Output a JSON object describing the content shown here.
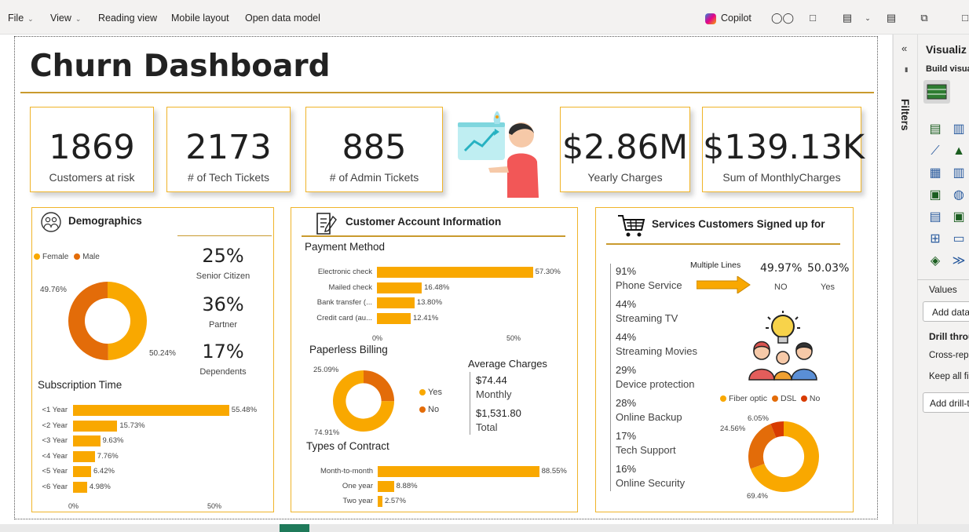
{
  "menubar": {
    "file": "File",
    "view": "View",
    "reading_view": "Reading view",
    "mobile_layout": "Mobile layout",
    "open_data_model": "Open data model",
    "copilot": "Copilot"
  },
  "report": {
    "title": "Churn Dashboard",
    "kpis": [
      {
        "value": "1869",
        "label": "Customers at risk"
      },
      {
        "value": "2173",
        "label": "# of Tech Tickets"
      },
      {
        "value": "885",
        "label": "# of Admin Tickets"
      },
      {
        "value": "$2.86M",
        "label": "Yearly Charges"
      },
      {
        "value": "$139.13K",
        "label": "Sum of MonthlyCharges"
      }
    ]
  },
  "demographics": {
    "title": "Demographics",
    "legend_female": "Female",
    "legend_male": "Male",
    "female_pct_label": "49.76%",
    "male_pct_label": "50.24%",
    "senior_value": "25%",
    "senior_label": "Senior Citizen",
    "partner_value": "36%",
    "partner_label": "Partner",
    "dependents_value": "17%",
    "dependents_label": "Dependents",
    "subscription_title": "Subscription Time",
    "axis_start": "0%",
    "axis_mid": "50%"
  },
  "account": {
    "title": "Customer Account Information",
    "payment_title": "Payment Method",
    "payment_axis_start": "0%",
    "payment_axis_mid": "50%",
    "paperless_title": "Paperless Billing",
    "paperless_yes": "Yes",
    "paperless_no": "No",
    "paperless_no_label": "25.09%",
    "paperless_yes_label": "74.91%",
    "avg_title": "Average Charges",
    "avg_monthly_value": "$74.44",
    "avg_monthly_label": "Monthly",
    "avg_total_value": "$1,531.80",
    "avg_total_label": "Total",
    "contract_title": "Types of Contract"
  },
  "services": {
    "title": "Services Customers Signed up for",
    "items": [
      {
        "pct": "91%",
        "name": "Phone Service"
      },
      {
        "pct": "44%",
        "name": "Streaming TV"
      },
      {
        "pct": "44%",
        "name": "Streaming Movies"
      },
      {
        "pct": "29%",
        "name": "Device protection"
      },
      {
        "pct": "28%",
        "name": "Online Backup"
      },
      {
        "pct": "17%",
        "name": "Tech Support"
      },
      {
        "pct": "16%",
        "name": "Online Security"
      }
    ],
    "multiple_lines_label": "Multiple Lines",
    "ml_no_value": "49.97%",
    "ml_no_label": "NO",
    "ml_yes_value": "50.03%",
    "ml_yes_label": "Yes",
    "legend_fiber": "Fiber optic",
    "legend_dsl": "DSL",
    "legend_no": "No",
    "internet_no_label": "6.05%",
    "internet_dsl_label": "24.56%",
    "internet_fiber_label": "69.4%"
  },
  "right_panel": {
    "filters": "Filters",
    "visualizations": "Visualiz",
    "build_visual": "Build visua",
    "values": "Values",
    "add_data": "Add data",
    "drill_through": "Drill throu",
    "cross_report": "Cross-repo",
    "keep_all": "Keep all fi",
    "add_drill": "Add drill-t"
  },
  "colors": {
    "accent": "#f9a800",
    "dark_orange": "#e36c09",
    "red": "#d83b01",
    "border": "#f0b429"
  },
  "chart_data": [
    {
      "type": "pie",
      "title": "",
      "categories": [
        "Female",
        "Male"
      ],
      "values": [
        49.76,
        50.24
      ],
      "donut": true
    },
    {
      "type": "bar",
      "title": "Subscription Time",
      "categories": [
        "<1 Year",
        "<2 Year",
        "<3 Year",
        "<4 Year",
        "<5 Year",
        "<6 Year"
      ],
      "values": [
        55.48,
        15.73,
        9.63,
        7.76,
        6.42,
        4.98
      ],
      "value_labels": [
        "55.48%",
        "15.73%",
        "9.63%",
        "7.76%",
        "6.42%",
        "4.98%"
      ],
      "orientation": "horizontal",
      "xlim": [
        0,
        60
      ]
    },
    {
      "type": "bar",
      "title": "Payment Method",
      "categories": [
        "Electronic check",
        "Mailed check",
        "Bank transfer (...",
        "Credit card (au..."
      ],
      "values": [
        57.3,
        16.48,
        13.8,
        12.41
      ],
      "value_labels": [
        "57.30%",
        "16.48%",
        "13.80%",
        "12.41%"
      ],
      "orientation": "horizontal",
      "xlim": [
        0,
        60
      ]
    },
    {
      "type": "pie",
      "title": "Paperless Billing",
      "categories": [
        "Yes",
        "No"
      ],
      "values": [
        74.91,
        25.09
      ],
      "donut": true
    },
    {
      "type": "bar",
      "title": "Types of Contract",
      "categories": [
        "Month-to-month",
        "One year",
        "Two year"
      ],
      "values": [
        88.55,
        8.88,
        2.57
      ],
      "value_labels": [
        "88.55%",
        "8.88%",
        "2.57%"
      ],
      "orientation": "horizontal",
      "xlim": [
        0,
        90
      ]
    },
    {
      "type": "pie",
      "title": "",
      "categories": [
        "Fiber optic",
        "DSL",
        "No"
      ],
      "values": [
        69.4,
        24.56,
        6.05
      ],
      "donut": true
    }
  ]
}
